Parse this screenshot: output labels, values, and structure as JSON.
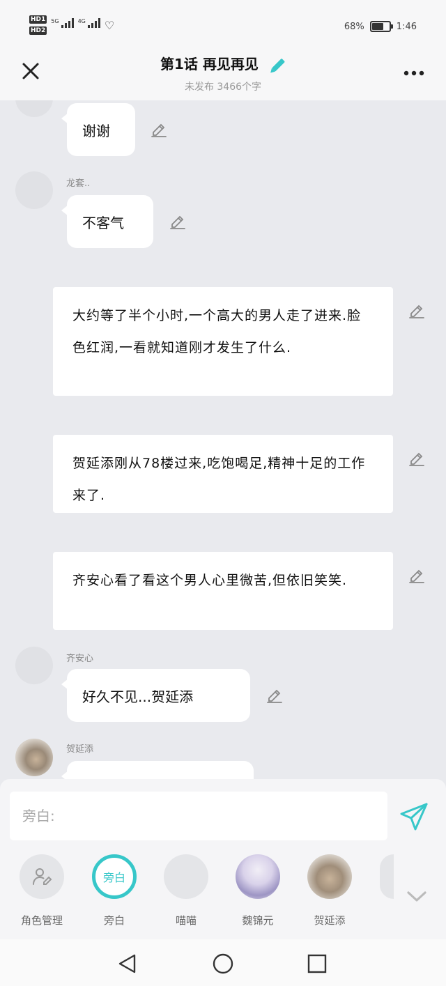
{
  "status_bar": {
    "hd1": "HD1",
    "hd2": "HD2",
    "net1": "5G",
    "net2": "4G",
    "battery_percent_text": "68%",
    "battery_level": 0.68,
    "time": "1:46"
  },
  "header": {
    "title": "第1话 再见再见",
    "subtitle": "未发布 3466个字"
  },
  "messages": [
    {
      "type": "character",
      "sender": "",
      "text": "谢谢"
    },
    {
      "type": "character",
      "sender": "龙套..",
      "text": "不客气"
    },
    {
      "type": "narration",
      "text": "大约等了半个小时,一个高大的男人走了进来.脸色红润,一看就知道刚才发生了什么."
    },
    {
      "type": "narration",
      "text": "贺延添刚从78楼过来,吃饱喝足,精神十足的工作来了."
    },
    {
      "type": "narration",
      "text": "齐安心看了看这个男人心里微苦,但依旧笑笑."
    },
    {
      "type": "character",
      "sender": "齐安心",
      "text": "好久不见...贺延添"
    },
    {
      "type": "character",
      "sender": "贺延添",
      "text": ""
    }
  ],
  "input": {
    "placeholder": "旁白:"
  },
  "roles": [
    {
      "label": "角色管理",
      "icon": "role-manage-icon"
    },
    {
      "label": "旁白",
      "inner": "旁白",
      "active": true
    },
    {
      "label": "喵喵"
    },
    {
      "label": "魏锦元"
    },
    {
      "label": "贺延添"
    }
  ],
  "colors": {
    "accent": "#37c7c9",
    "chat_bg": "#e9eaee",
    "bubble_bg": "#ffffff"
  },
  "icons": {
    "close": "close-icon",
    "more": "more-icon",
    "edit": "edit-pencil-icon",
    "send": "send-icon",
    "collapse": "chevron-down-icon"
  }
}
